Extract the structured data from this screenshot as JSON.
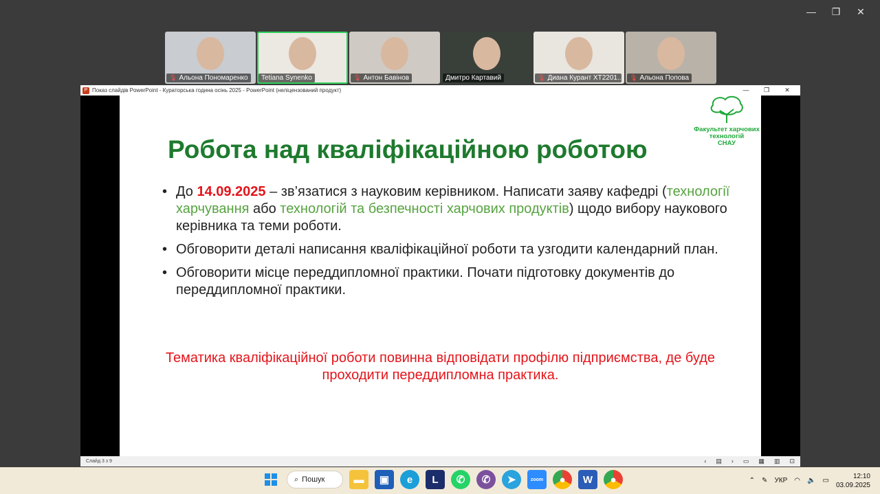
{
  "window_controls": {
    "minimize": "—",
    "restore": "❐",
    "close": "✕"
  },
  "participants": [
    {
      "name": "Альона Пономаренко",
      "muted": true,
      "active": false,
      "bg": "#c9ccd0"
    },
    {
      "name": "Tetiana Synenko",
      "muted": false,
      "active": true,
      "bg": "#ece8e2"
    },
    {
      "name": "Антон Бавінов",
      "muted": true,
      "active": false,
      "bg": "#cfcac3"
    },
    {
      "name": "Дмитро Картавий",
      "muted": false,
      "active": false,
      "bg": "#39403a"
    },
    {
      "name": "Диана Курант ХТ2201...",
      "muted": true,
      "active": false,
      "bg": "#e9e5df"
    },
    {
      "name": "Альона Попова",
      "muted": true,
      "active": false,
      "bg": "#b9b2a8"
    }
  ],
  "ppt": {
    "window_title": "Показ слайдів PowerPoint  -  Кураторська година осінь 2025 - PowerPoint (неліцензований продукт)",
    "status_slide": "Слайд 3 з 9"
  },
  "slide": {
    "title": "Робота над кваліфікаційною роботою",
    "logo_text": [
      "Факультет харчових",
      "технологій",
      "СНАУ"
    ],
    "b1_pre": "До ",
    "b1_date": "14.09.2025",
    "b1_mid": " – зв’язатися з науковим керівником. Написати заяву кафедрі (",
    "b1_dept1": "технології харчування",
    "b1_or": " або ",
    "b1_dept2": "технологій та безпечності харчових продуктів",
    "b1_post": ") щодо вибору наукового керівника та теми роботи.",
    "b2": "Обговорити деталі написання кваліфікаційної роботи та узгодити календарний план.",
    "b3": "Обговорити місце переддипломної практики. Почати підготовку документів до переддипломної практики.",
    "note": "Тематика кваліфікаційної роботи повинна відповідати профілю підприємства, де буде проходити переддипломна практика."
  },
  "taskbar": {
    "search_label": "Пошук",
    "language": "УКР",
    "time": "12:10",
    "date": "03.09.2025"
  },
  "colors": {
    "title_green": "#1e7a2e",
    "accent_red": "#e3141a",
    "dept_green": "#56a340",
    "taskbar": "#f2ead8"
  }
}
